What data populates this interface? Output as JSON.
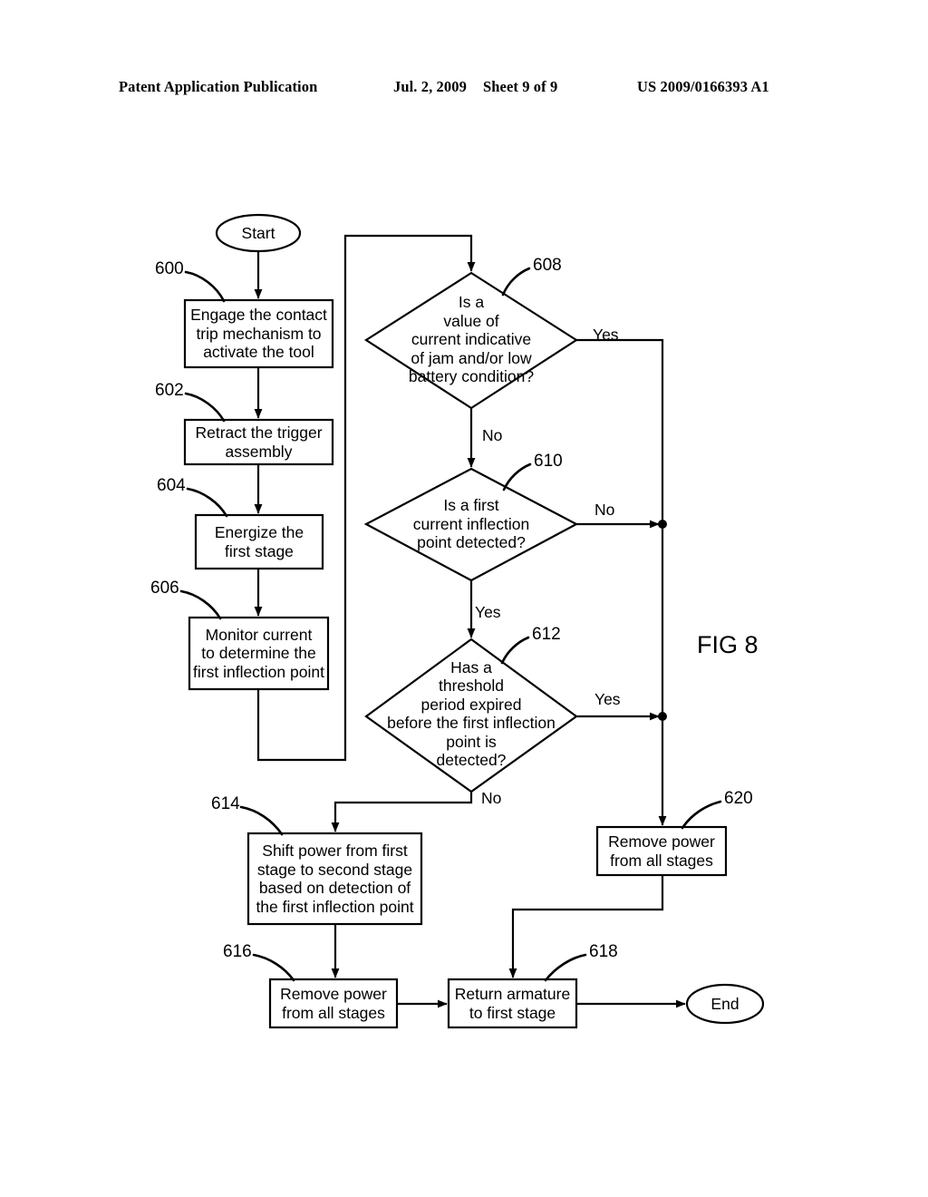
{
  "header": {
    "title": "Patent Application Publication",
    "date": "Jul. 2, 2009",
    "sheet": "Sheet 9 of 9",
    "patent_number": "US 2009/0166393 A1"
  },
  "figure": {
    "label": "FIG 8"
  },
  "terminals": {
    "start": "Start",
    "end": "End"
  },
  "nodes": {
    "n600": {
      "ref": "600",
      "text": "Engage the contact\ntrip mechanism to\nactivate the tool",
      "shape": "process"
    },
    "n602": {
      "ref": "602",
      "text": "Retract the trigger\nassembly",
      "shape": "process"
    },
    "n604": {
      "ref": "604",
      "text": "Energize the\nfirst stage",
      "shape": "process"
    },
    "n606": {
      "ref": "606",
      "text": "Monitor current\nto determine the\nfirst inflection point",
      "shape": "process"
    },
    "n608": {
      "ref": "608",
      "text": "Is a\nvalue of\ncurrent indicative\nof jam and/or low\nbattery condition?",
      "shape": "decision"
    },
    "n610": {
      "ref": "610",
      "text": "Is a first\ncurrent inflection\npoint detected?",
      "shape": "decision"
    },
    "n612": {
      "ref": "612",
      "text": "Has a\nthreshold\nperiod expired\nbefore the first inflection\npoint is\ndetected?",
      "shape": "decision"
    },
    "n614": {
      "ref": "614",
      "text": "Shift power from first\nstage to second stage\nbased on detection of\nthe first inflection point",
      "shape": "process"
    },
    "n616": {
      "ref": "616",
      "text": "Remove power\nfrom all stages",
      "shape": "process"
    },
    "n618": {
      "ref": "618",
      "text": "Return armature\nto first stage",
      "shape": "process"
    },
    "n620": {
      "ref": "620",
      "text": "Remove power\nfrom all stages",
      "shape": "process"
    }
  },
  "edge_labels": {
    "e608_yes": "Yes",
    "e608_no": "No",
    "e610_no": "No",
    "e610_yes": "Yes",
    "e612_yes": "Yes",
    "e612_no": "No"
  },
  "colors": {
    "ink": "#000000",
    "paper": "#ffffff"
  }
}
